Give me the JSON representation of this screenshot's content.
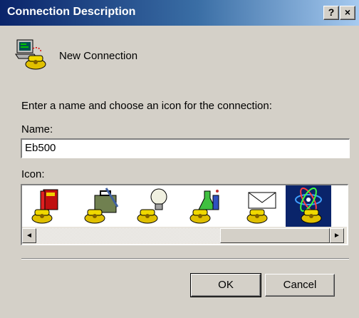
{
  "window": {
    "title": "Connection Description",
    "help_glyph": "?",
    "close_glyph": "×"
  },
  "header": {
    "icon": "phone-computer-icon",
    "label": "New Connection"
  },
  "form": {
    "prompt": "Enter a name and choose an icon for the connection:",
    "name_label": "Name:",
    "name_value": "Eb500",
    "icon_label": "Icon:"
  },
  "icon_list": {
    "items": [
      {
        "name": "book-phone-icon"
      },
      {
        "name": "briefcase-phone-icon"
      },
      {
        "name": "lightbulb-phone-icon"
      },
      {
        "name": "lab-flask-phone-icon"
      },
      {
        "name": "envelope-phone-icon"
      },
      {
        "name": "atom-phone-icon",
        "selected": true
      }
    ],
    "scroll_left_glyph": "◄",
    "scroll_right_glyph": "►"
  },
  "buttons": {
    "ok_label": "OK",
    "cancel_label": "Cancel"
  },
  "colors": {
    "titlebar_start": "#0a246a",
    "titlebar_end": "#a6caf0",
    "dialog_face": "#d4d0c8",
    "selection": "#0a246a"
  }
}
